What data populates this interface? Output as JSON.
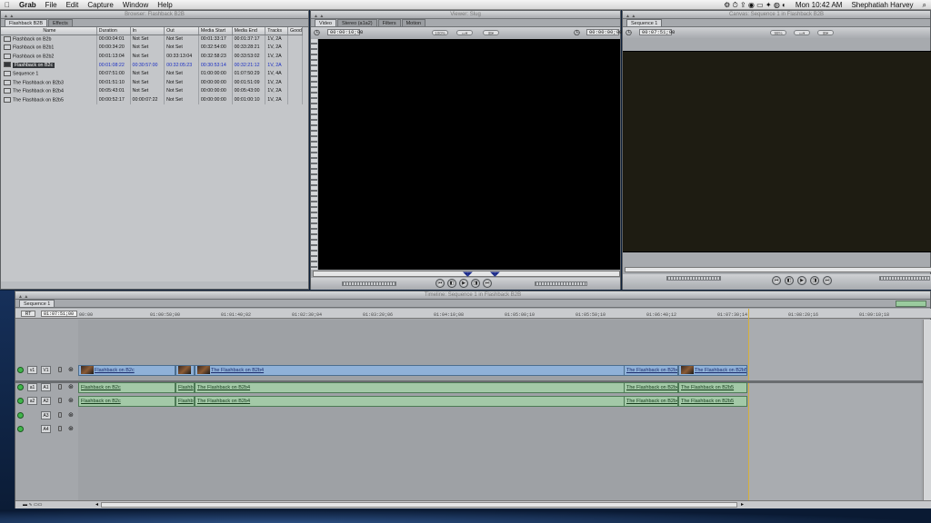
{
  "menubar": {
    "apple": "",
    "app": "Grab",
    "menus": [
      "File",
      "Edit",
      "Capture",
      "Window",
      "Help"
    ],
    "clock": "Mon 10:42 AM",
    "user": "Shephatiah Harvey"
  },
  "browser": {
    "title": "Browser: Flashback B2B",
    "tabs": [
      "Flashback B2B",
      "Effects"
    ],
    "columns": [
      "Name",
      "Duration",
      "In",
      "Out",
      "Media Start",
      "Media End",
      "Tracks",
      "Good"
    ],
    "rows": [
      [
        "Flashback on B2b",
        "00:00:04:01",
        "Not Set",
        "Not Set",
        "00:01:33:17",
        "00:01:37:17",
        "1V, 2A"
      ],
      [
        "Flashback on B2b1",
        "00:00:34:20",
        "Not Set",
        "Not Set",
        "00:32:54:00",
        "00:33:28:21",
        "1V, 2A"
      ],
      [
        "Flashback on B2b2",
        "00:01:13:04",
        "Not Set",
        "00:33:13:04",
        "00:32:58:23",
        "00:33:53:02",
        "1V, 2A"
      ],
      [
        "Flashback on B2c",
        "00:01:08:22",
        "00:30:57:00",
        "00:32:05:23",
        "00:30:53:14",
        "00:32:21:12",
        "1V, 2A"
      ],
      [
        "Sequence 1",
        "00:07:51:00",
        "Not Set",
        "Not Set",
        "01:00:00:00",
        "01:07:50:29",
        "1V, 4A"
      ],
      [
        "The Flashback on B2b3",
        "00:01:51:10",
        "Not Set",
        "Not Set",
        "00:00:00:00",
        "00:01:51:09",
        "1V, 2A"
      ],
      [
        "The Flashback on B2b4",
        "00:05:43:01",
        "Not Set",
        "Not Set",
        "00:00:00:00",
        "00:05:43:00",
        "1V, 2A"
      ],
      [
        "The Flashback on B2b5",
        "00:00:52:17",
        "00:00:07:22",
        "Not Set",
        "00:00:00:00",
        "00:01:00:10",
        "1V, 2A"
      ]
    ],
    "selected_index": 3
  },
  "viewer": {
    "title": "Viewer: Slug",
    "tabs": [
      "Video",
      "Stereo (a1a2)",
      "Filters",
      "Motion"
    ],
    "timecode_left": "00:00:10;00",
    "timecode_right": "00:00:00;00",
    "zoom": "100%"
  },
  "canvas": {
    "title": "Canvas: Sequence 1 in Flashback B2B",
    "tab": "Sequence 1",
    "timecode_left": "00:07:51;00",
    "zoom": "98%"
  },
  "timeline": {
    "title": "Timeline: Sequence 1 in Flashback B2B",
    "tab": "Sequence 1",
    "rt": "RT",
    "current_timecode": "01:07:51;00",
    "ruler": [
      "00:00",
      "01:00:50;00",
      "01:01:40;02",
      "01:02:30;04",
      "01:03:20;06",
      "01:04:10;08",
      "01:05:00;10",
      "01:05:50;10",
      "01:06:40;12",
      "01:07:30;14",
      "01:08:20;16",
      "01:09:10;18"
    ],
    "tracks": [
      {
        "src": "v1",
        "dst": "V1",
        "clips": [
          "Flashback on B2c",
          "",
          "The Flashback on B2b4",
          "The Flashback on B2b4",
          "The Flashback on B2b5"
        ]
      },
      {
        "src": "a1",
        "dst": "A1",
        "clips": [
          "Flashback on B2c",
          "Flashb",
          "The Flashback on B2b4",
          "The Flashback on B2b4",
          "The Flashback on B2b5"
        ]
      },
      {
        "src": "a2",
        "dst": "A2",
        "clips": [
          "Flashback on B2c",
          "Flashb",
          "The Flashback on B2b4",
          "The Flashback on B2b4",
          "The Flashback on B2b5"
        ]
      },
      {
        "src": "",
        "dst": "A3",
        "clips": []
      },
      {
        "src": "",
        "dst": "A4",
        "clips": []
      }
    ]
  },
  "colors": {
    "video_clip": "#8fb1d8",
    "audio_clip": "#a3c9a7",
    "selection_text": "#1b2fc4",
    "track_on": "#3fb54a"
  }
}
